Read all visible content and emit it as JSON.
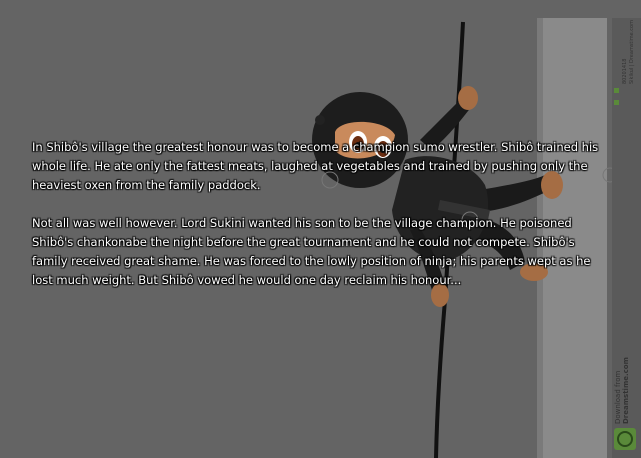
{
  "story": {
    "paragraph_1": "In Shibô's village the greatest honour was to become a champion sumo wrestler. Shibô trained his whole life. He ate only the fattest meats, laughed at vegetables and trained by pushing only the heaviest oxen from the family paddock.",
    "paragraph_2": "Not all was well however. Lord Sukini wanted his son to be the village champion. He poisoned Shibô's chankonabe the night before the great tournament and he could not compete. Shibô's family received great shame. He was forced to the lowly position of ninja; his parents wept as he lost much weight. But Shibô vowed he would one day reclaim his honour..."
  },
  "watermark": {
    "download_from": "Download from",
    "site": "Dreamstime.com",
    "top_id": "80201418",
    "top_credit": "Sikikul | Dreamstime.com"
  },
  "colors": {
    "overlay": "#646464",
    "text": "#ffffff",
    "ninja_suit": "#1c1c1c",
    "skin": "#c98a5c",
    "wall": "#d8d8d8"
  }
}
